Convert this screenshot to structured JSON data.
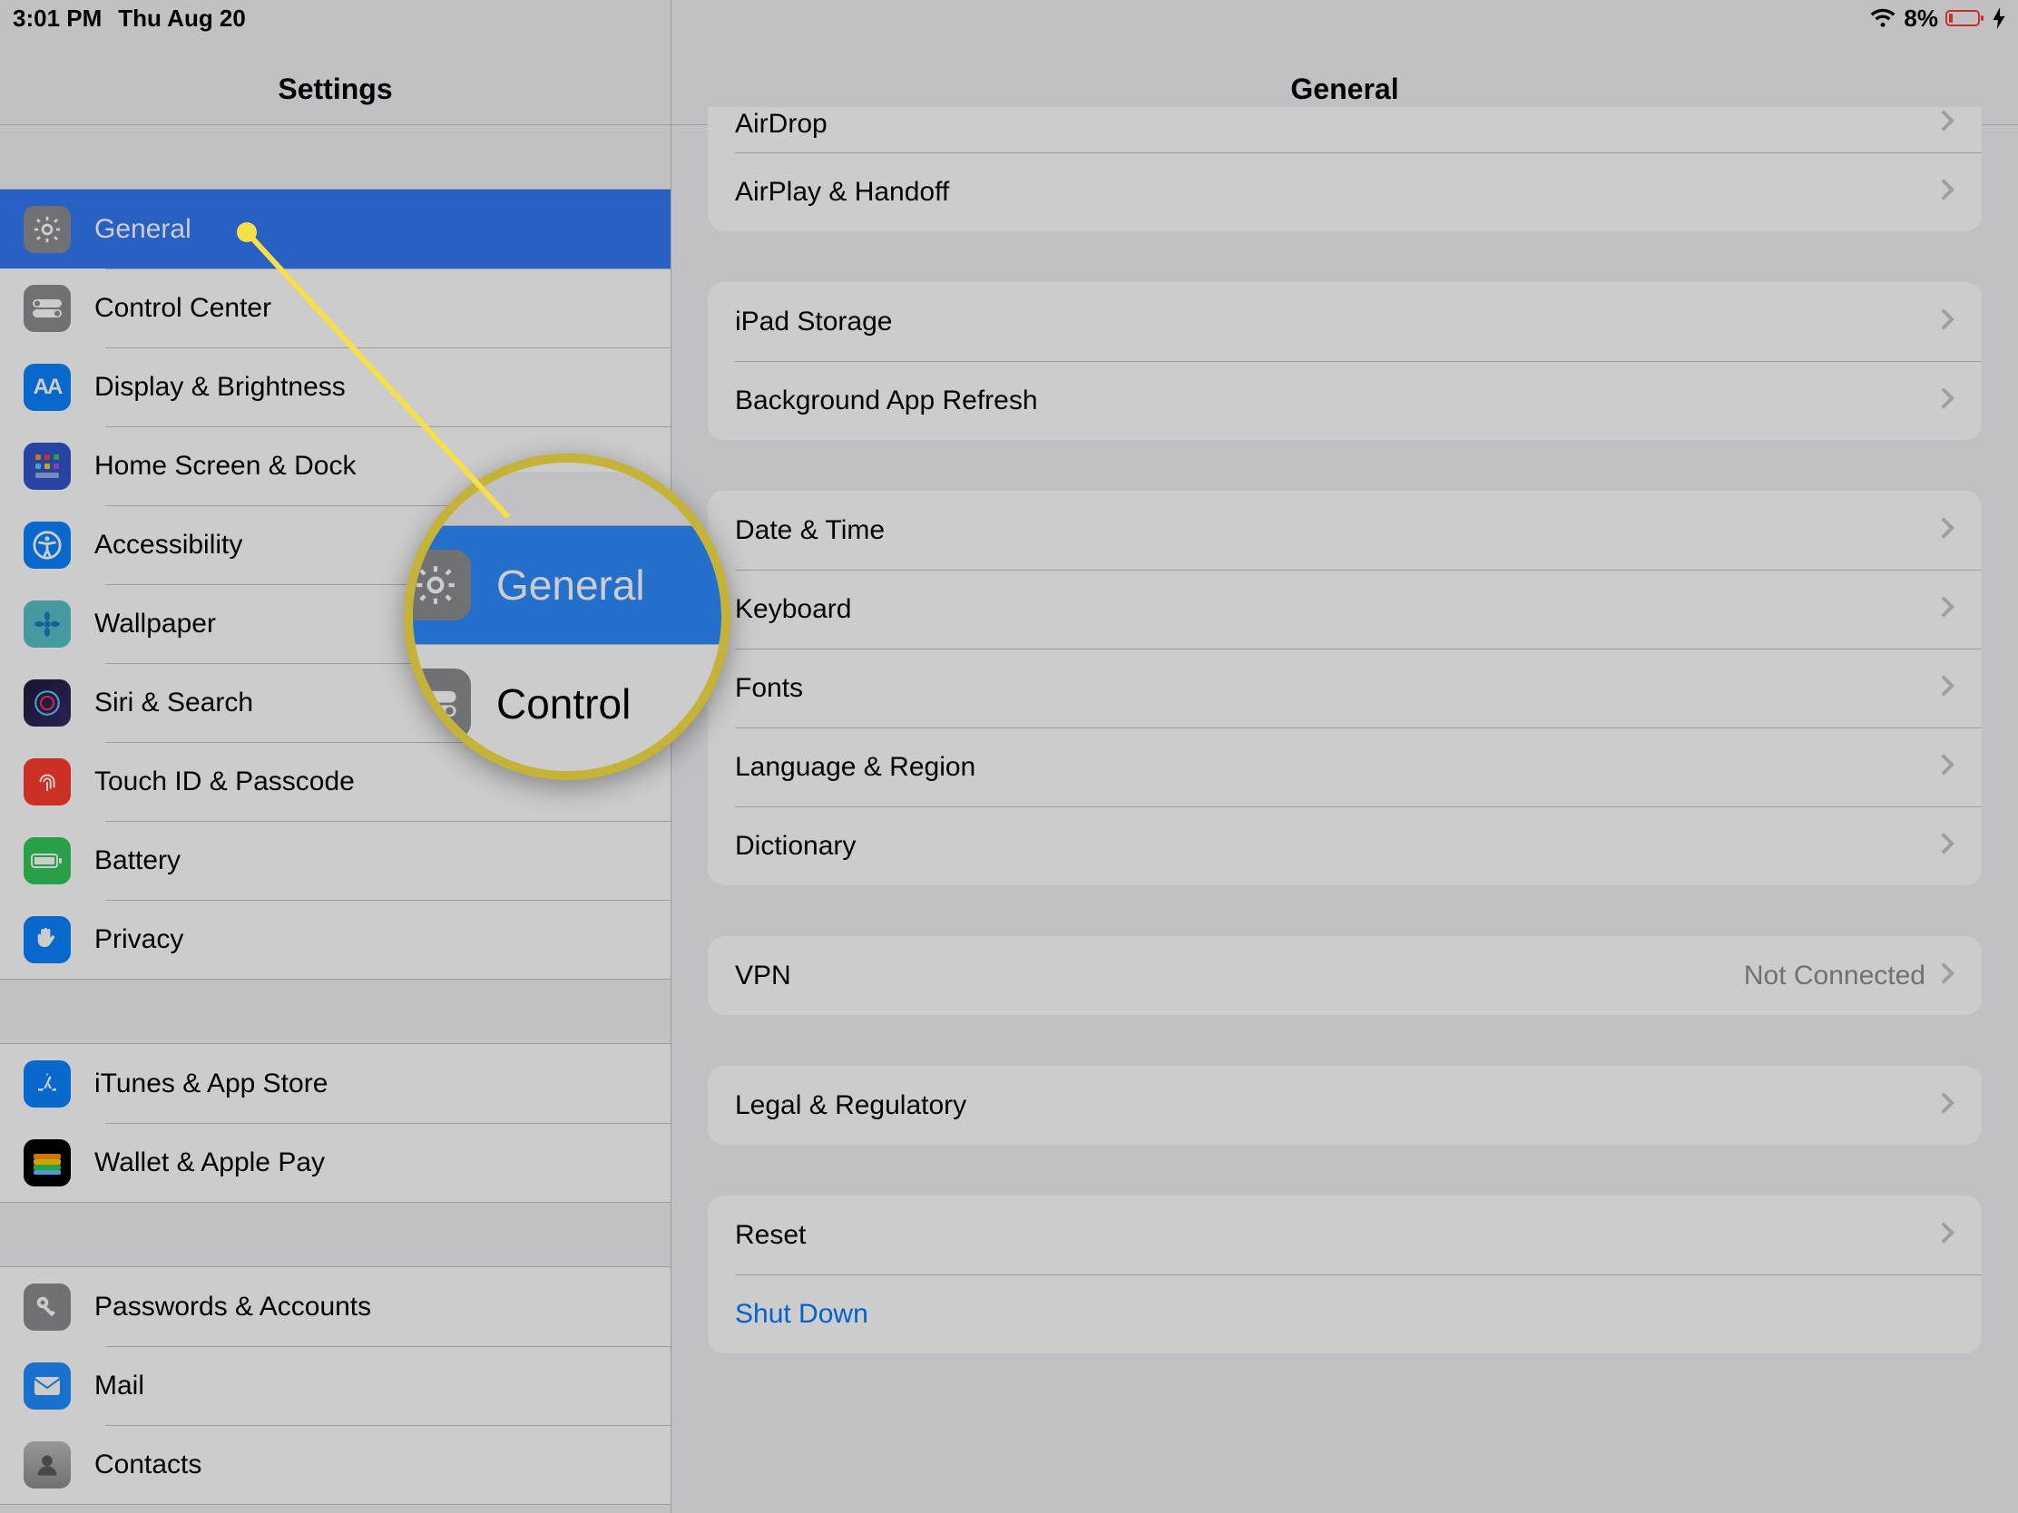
{
  "status": {
    "time": "3:01 PM",
    "date": "Thu Aug 20",
    "battery_pct": "8%"
  },
  "sidebar": {
    "title": "Settings",
    "group1": [
      {
        "id": "general",
        "label": "General",
        "selected": true
      },
      {
        "id": "control-center",
        "label": "Control Center"
      },
      {
        "id": "display-brightness",
        "label": "Display & Brightness"
      },
      {
        "id": "home-screen-dock",
        "label": "Home Screen & Dock"
      },
      {
        "id": "accessibility",
        "label": "Accessibility"
      },
      {
        "id": "wallpaper",
        "label": "Wallpaper"
      },
      {
        "id": "siri-search",
        "label": "Siri & Search"
      },
      {
        "id": "touch-id-passcode",
        "label": "Touch ID & Passcode"
      },
      {
        "id": "battery",
        "label": "Battery"
      },
      {
        "id": "privacy",
        "label": "Privacy"
      }
    ],
    "group2": [
      {
        "id": "itunes-app-store",
        "label": "iTunes & App Store"
      },
      {
        "id": "wallet-apple-pay",
        "label": "Wallet & Apple Pay"
      }
    ],
    "group3": [
      {
        "id": "passwords-accounts",
        "label": "Passwords & Accounts"
      },
      {
        "id": "mail",
        "label": "Mail"
      },
      {
        "id": "contacts",
        "label": "Contacts"
      }
    ]
  },
  "detail": {
    "title": "General",
    "group0": [
      {
        "id": "airdrop",
        "label": "AirDrop"
      },
      {
        "id": "airplay-handoff",
        "label": "AirPlay & Handoff"
      }
    ],
    "group1": [
      {
        "id": "ipad-storage",
        "label": "iPad Storage"
      },
      {
        "id": "background-app-refresh",
        "label": "Background App Refresh"
      }
    ],
    "group2": [
      {
        "id": "date-time",
        "label": "Date & Time"
      },
      {
        "id": "keyboard",
        "label": "Keyboard"
      },
      {
        "id": "fonts",
        "label": "Fonts"
      },
      {
        "id": "language-region",
        "label": "Language & Region"
      },
      {
        "id": "dictionary",
        "label": "Dictionary"
      }
    ],
    "group3": [
      {
        "id": "vpn",
        "label": "VPN",
        "value": "Not Connected"
      }
    ],
    "group4": [
      {
        "id": "legal-regulatory",
        "label": "Legal & Regulatory"
      }
    ],
    "group5": [
      {
        "id": "reset",
        "label": "Reset"
      },
      {
        "id": "shut-down",
        "label": "Shut Down",
        "link": true,
        "no_chevron": true
      }
    ]
  },
  "callout": {
    "mag_row1": "General",
    "mag_row2": "Control"
  }
}
